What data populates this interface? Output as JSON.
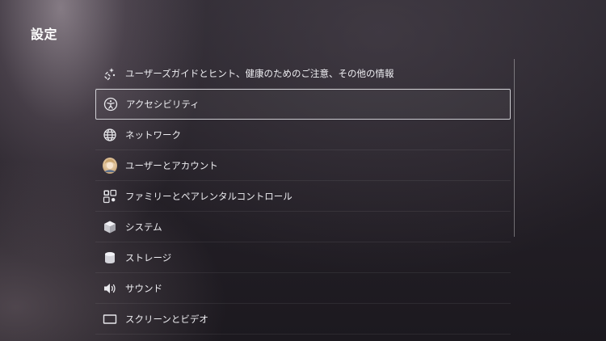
{
  "page": {
    "title": "設定"
  },
  "menu": {
    "items": [
      {
        "icon": "sparkle-guide-icon",
        "label": "ユーザーズガイドとヒント、健康のためのご注意、その他の情報"
      },
      {
        "icon": "accessibility-icon",
        "label": "アクセシビリティ"
      },
      {
        "icon": "globe-icon",
        "label": "ネットワーク"
      },
      {
        "icon": "avatar-icon",
        "label": "ユーザーとアカウント"
      },
      {
        "icon": "family-controls-icon",
        "label": "ファミリーとペアレンタルコントロール"
      },
      {
        "icon": "cube-icon",
        "label": "システム"
      },
      {
        "icon": "storage-icon",
        "label": "ストレージ"
      },
      {
        "icon": "speaker-icon",
        "label": "サウンド"
      },
      {
        "icon": "screen-icon",
        "label": "スクリーンとビデオ"
      }
    ],
    "selected_index": 1
  },
  "colors": {
    "background": "#241f27",
    "text": "#eeeef2",
    "selection_border": "#e6e6eb"
  }
}
